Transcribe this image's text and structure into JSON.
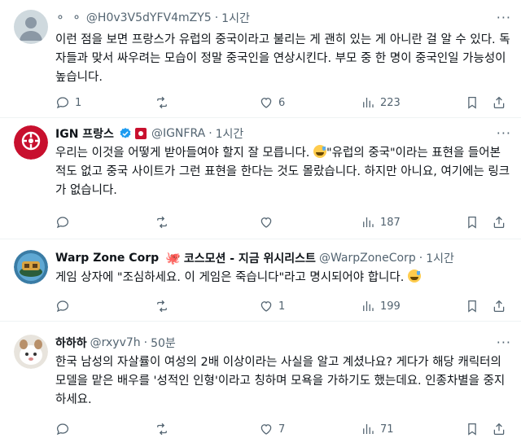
{
  "tweets": [
    {
      "name": "⚬ ⚬",
      "handle": "@H0v3V5dYFV4mZY5",
      "time": "1시간",
      "text": "이런 점을 보면 프랑스가 유럽의 중국이라고 불리는 게 괜히 있는 게 아니란 걸 알 수 있다. 독자들과 맞서 싸우려는 모습이 정말 중국인을 연상시킨다. 부모 중 한 명이 중국인일 가능성이 높습니다.",
      "replies": "1",
      "retweets": "",
      "likes": "6",
      "views": "223"
    },
    {
      "name": "IGN 프랑스",
      "handle": "@IGNFRA",
      "time": "1시간",
      "avatar_label": "FRANCE",
      "text_before": "우리는 이것을 어떻게 받아들여야 할지 잘 모릅니다. ",
      "text_after": "\"유럽의 중국\"이라는 표현을 들어본 적도 없고 중국 사이트가 그런 표현을 한다는 것도 몰랐습니다. 하지만 아니요, 여기에는 링크가 없습니다.",
      "replies": "",
      "retweets": "",
      "likes": "",
      "views": "187"
    },
    {
      "name": "Warp Zone Corp",
      "name_suffix": "코스모션 - 지금 위시리스트",
      "handle": "@WarpZoneCorp",
      "time": "1시간",
      "text": "게임 상자에 \"조심하세요. 이 게임은 죽습니다\"라고 명시되어야 합니다.",
      "replies": "",
      "retweets": "",
      "likes": "1",
      "views": "199"
    },
    {
      "name": "하하하",
      "handle": "@rxyv7h",
      "time": "50분",
      "text": "한국 남성의 자살률이 여성의 2배 이상이라는 사실을 알고 계셨나요? 게다가 해당 캐릭터의 모델을 맡은 배우를 '성적인 인형'이라고 칭하며 모욕을 가하기도 했는데요. 인종차별을 중지하세요.",
      "replies": "",
      "retweets": "",
      "likes": "7",
      "views": "71"
    }
  ],
  "ui": {
    "dot": "·",
    "more": "···"
  },
  "colors": {
    "text": "#0f1419",
    "muted": "#536471",
    "verified": "#1d9bf0",
    "ign_red": "#c8102e"
  }
}
